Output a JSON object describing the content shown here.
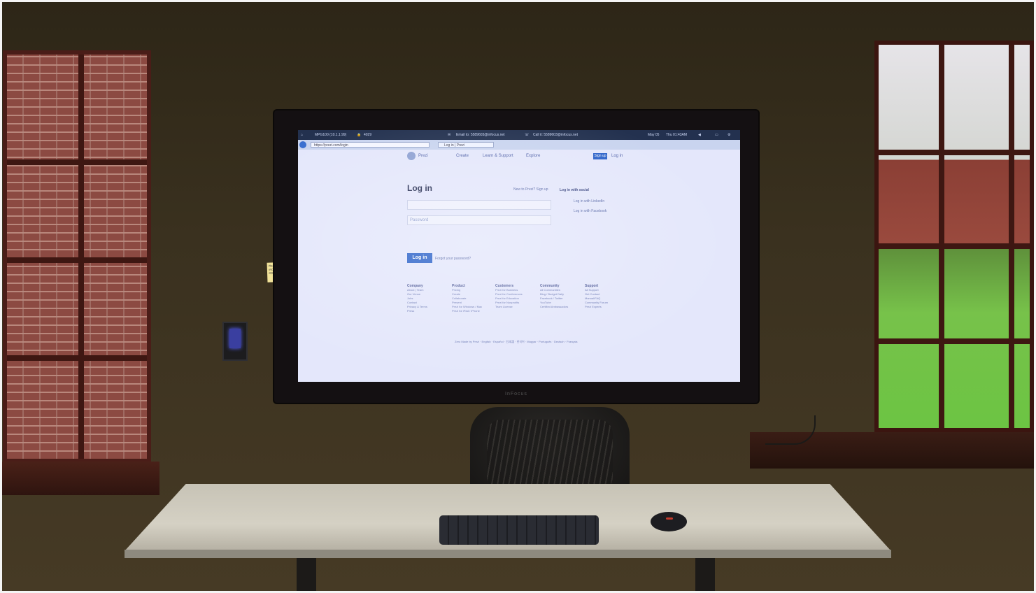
{
  "screen": {
    "statusbar": {
      "host": "MPG100 (10.1.1.99)",
      "count": "4029",
      "email_label": "Email to: 5589603@infocus.net",
      "call_label": "Call it: 5589603@infocus.net",
      "date": "May 05",
      "time": "Thu 01:43AM"
    },
    "browser": {
      "address": "https://prezi.com/login",
      "tab_title": "Log in | Prezi"
    },
    "nav": {
      "logo": "Prezi",
      "items": [
        "Create",
        "Learn & Support",
        "Explore"
      ],
      "signup": "Sign up",
      "login": "Log in"
    },
    "login": {
      "title": "Log in",
      "new_to_prezi": "New to Prezi? Sign up",
      "social_title": "Log in with social",
      "linkedin": "Log in with LinkedIn",
      "facebook": "Log in with Facebook",
      "email_placeholder": "",
      "password_placeholder": "Password",
      "button": "Log in",
      "forgot": "Forgot your password?"
    },
    "footer": [
      {
        "heading": "Company",
        "links": [
          "About | Team",
          "Our Venue",
          "Jobs",
          "Contact",
          "Privacy & Terms",
          "Press"
        ]
      },
      {
        "heading": "Product",
        "links": [
          "Pricing",
          "Create",
          "Collaborate",
          "Present",
          "Prezi for Windows / Mac",
          "Prezi for iPad / iPhone"
        ]
      },
      {
        "heading": "Customers",
        "links": [
          "Prezi for Business",
          "Prezi for Conferences",
          "Prezi for Education",
          "Prezi for Nonprofits",
          "Team License"
        ]
      },
      {
        "heading": "Community",
        "links": [
          "All Communities",
          "Blog / Budget Daily",
          "Facebook / Twitter",
          "YouTube",
          "Certified Ambassadors"
        ]
      },
      {
        "heading": "Support",
        "links": [
          "All Support",
          "Get Contact",
          "Manual/FAQ",
          "Community Forum",
          "Prezi Experts"
        ]
      }
    ],
    "copyright": "Zero Made by Prezi · English · Español · 日本語 · 한국어 · Magyar · Português · Deutsch · Français"
  },
  "monitor_brand": "InFocus",
  "sticky_note": "Please do not unplug or change input",
  "colors": {
    "wall": "#3a311f",
    "screen": "#e4e7fb",
    "accent": "#2d63c9",
    "frame": "#141012",
    "desk": "#d0ccbf"
  }
}
